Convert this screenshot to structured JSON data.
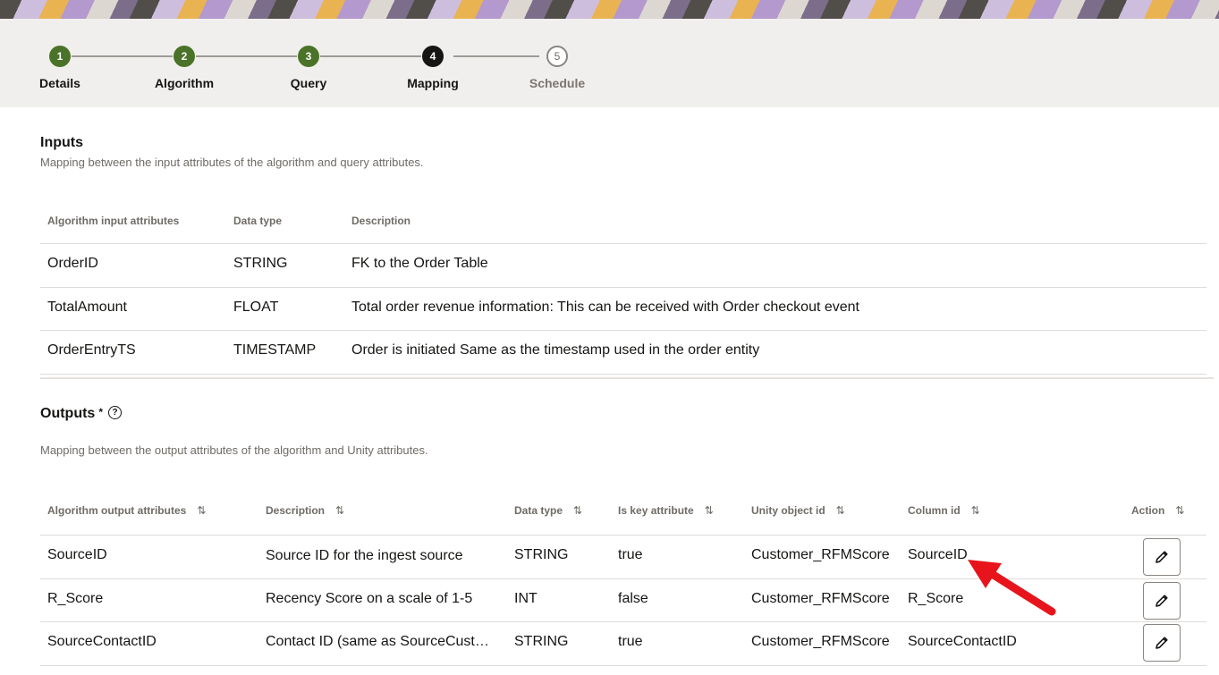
{
  "train": {
    "steps": [
      {
        "number": "1",
        "label": "Details",
        "state": "done"
      },
      {
        "number": "2",
        "label": "Algorithm",
        "state": "done"
      },
      {
        "number": "3",
        "label": "Query",
        "state": "done"
      },
      {
        "number": "4",
        "label": "Mapping",
        "state": "current"
      },
      {
        "number": "5",
        "label": "Schedule",
        "state": "todo"
      }
    ]
  },
  "inputs": {
    "title": "Inputs",
    "description": "Mapping between the input attributes of the algorithm and query attributes.",
    "headers": [
      "Algorithm input attributes",
      "Data type",
      "Description"
    ],
    "rows": [
      [
        "OrderID",
        "STRING",
        "FK to the Order Table"
      ],
      [
        "TotalAmount",
        "FLOAT",
        "Total order revenue information: This can be received with Order checkout event"
      ],
      [
        "OrderEntryTS",
        "TIMESTAMP",
        "Order is initiated Same as the timestamp used in the order entity"
      ]
    ]
  },
  "outputs": {
    "title": "Outputs",
    "required_mark": "*",
    "help_icon_glyph": "?",
    "description": "Mapping between the output attributes of the algorithm and Unity attributes.",
    "headers": [
      "Algorithm output attributes",
      "Description",
      "Data type",
      "Is key attribute",
      "Unity object id",
      "Column id",
      "Action"
    ],
    "rows": [
      [
        "SourceID",
        "Source ID for the ingest source",
        "STRING",
        "true",
        "Customer_RFMScore",
        "SourceID"
      ],
      [
        "R_Score",
        "Recency Score on a scale of 1-5",
        "INT",
        "false",
        "Customer_RFMScore",
        "R_Score"
      ],
      [
        "SourceContactID",
        "Contact ID (same as SourceCust…",
        "STRING",
        "true",
        "Customer_RFMScore",
        "SourceContactID"
      ]
    ]
  },
  "icons": {
    "sort": "sort-icon",
    "edit": "pencil-icon",
    "annotation": "red-arrow-annotation"
  },
  "colors": {
    "step_done": "#4a7228",
    "step_current": "#161513",
    "annotation": "#e8141b"
  }
}
